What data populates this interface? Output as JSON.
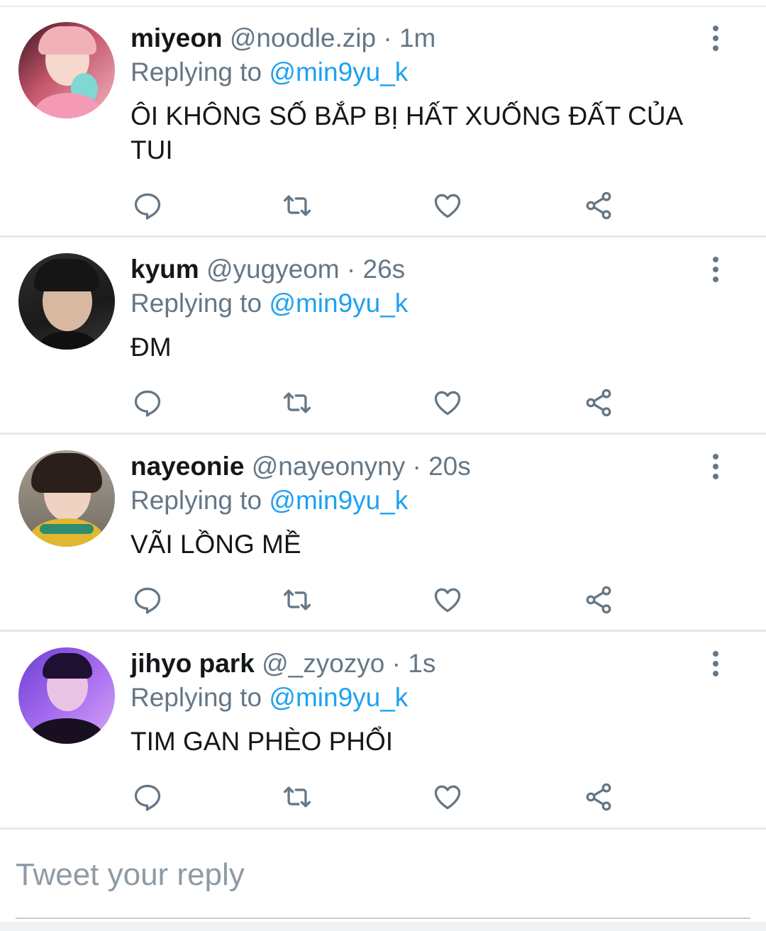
{
  "colors": {
    "accent": "#1da1f2",
    "secondary_text": "#657786",
    "primary_text": "#14171a",
    "divider": "#e6e9eb"
  },
  "icons": {
    "reply": "comment-bubble-icon",
    "retweet": "retweet-icon",
    "like": "heart-icon",
    "share": "share-icon",
    "more": "vertical-dots-icon"
  },
  "tweets": [
    {
      "name": "miyeon",
      "handle": "@noodle.zip",
      "sep": "·",
      "time": "1m",
      "replying_prefix": "Replying to ",
      "replying_to": "@min9yu_k",
      "text": "ÔI KHÔNG SỐ BẮP BỊ HẤT XUỐNG ĐẤT CỦA TUI"
    },
    {
      "name": "kyum",
      "handle": "@yugyeom",
      "sep": "·",
      "time": "26s",
      "replying_prefix": "Replying to ",
      "replying_to": "@min9yu_k",
      "text": "ĐM"
    },
    {
      "name": "nayeonie",
      "handle": "@nayeonyny",
      "sep": "·",
      "time": "20s",
      "replying_prefix": "Replying to ",
      "replying_to": "@min9yu_k",
      "text": "VÃI LỒNG MỀ"
    },
    {
      "name": "jihyo park",
      "handle": "@_zyozyo",
      "sep": "·",
      "time": "1s",
      "replying_prefix": "Replying to ",
      "replying_to": "@min9yu_k",
      "text": "TIM GAN PHÈO PHỔI"
    }
  ],
  "compose": {
    "placeholder": "Tweet your reply"
  }
}
